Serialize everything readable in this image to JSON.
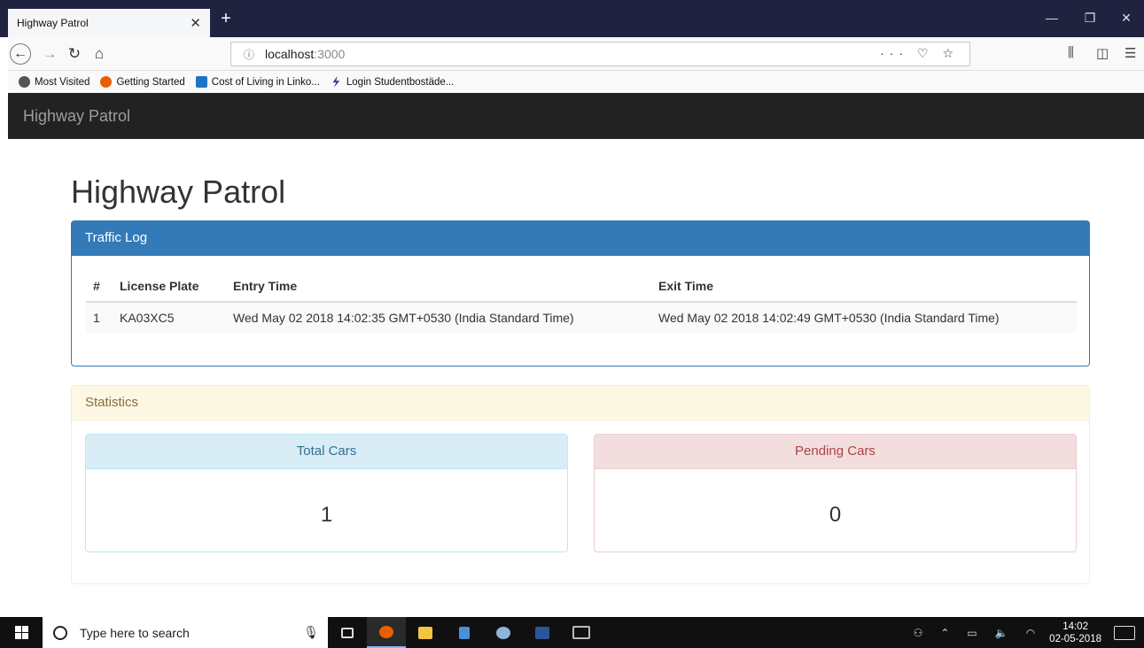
{
  "browser": {
    "tab_title": "Highway Patrol",
    "tab_close": "✕",
    "new_tab": "+",
    "window_controls": [
      "—",
      "❐",
      "✕"
    ],
    "url_info_icon": "ⓘ",
    "url_host": "localhost",
    "url_port": ":3000",
    "url_actions": "··· ♡ ☆",
    "bookmarks": [
      {
        "label": "Most Visited",
        "icon": "gear-icon",
        "color": "#555555"
      },
      {
        "label": "Getting Started",
        "icon": "firefox-icon",
        "color": "#e66000"
      },
      {
        "label": "Cost of Living in Linko...",
        "icon": "numbeo-icon",
        "color": "#1a73c9"
      },
      {
        "label": "Login Studentbostäde...",
        "icon": "bolt-icon",
        "color": "#2a3f8f"
      }
    ]
  },
  "app": {
    "brand": "Highway Patrol",
    "page_title": "Highway Patrol",
    "traffic_log": {
      "heading": "Traffic Log",
      "columns": [
        "#",
        "License Plate",
        "Entry Time",
        "Exit Time"
      ],
      "rows": [
        [
          "1",
          "KA03XC5",
          "Wed May 02 2018 14:02:35 GMT+0530 (India Standard Time)",
          "Wed May 02 2018 14:02:49 GMT+0530 (India Standard Time)"
        ]
      ]
    },
    "statistics": {
      "heading": "Statistics",
      "total_cars": {
        "label": "Total Cars",
        "value": "1"
      },
      "pending_cars": {
        "label": "Pending Cars",
        "value": "0"
      }
    }
  },
  "taskbar": {
    "search_placeholder": "Type here to search",
    "time": "14:02",
    "date": "02-05-2018"
  }
}
